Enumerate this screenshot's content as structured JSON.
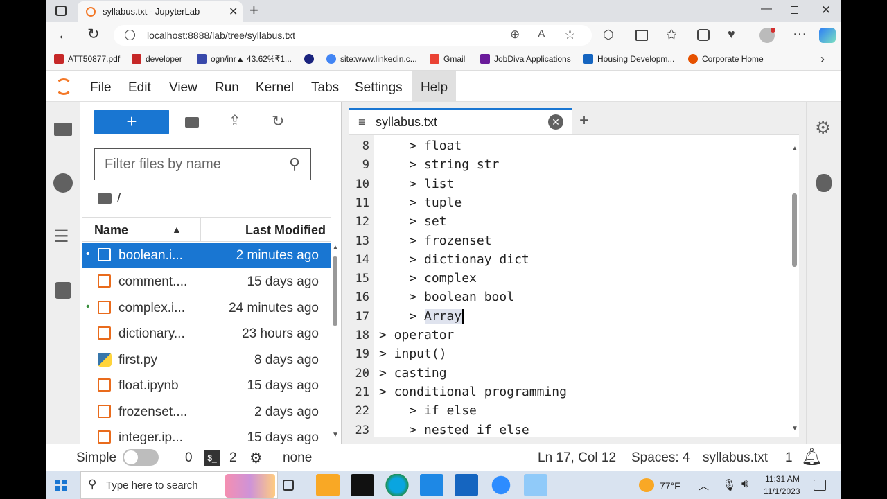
{
  "browser": {
    "tab_title": "syllabus.txt - JupyterLab",
    "url": "localhost:8888/lab/tree/syllabus.txt",
    "bookmarks": [
      {
        "label": "ATT50877.pdf",
        "color": "#c62828"
      },
      {
        "label": "developer",
        "color": "#c62828"
      },
      {
        "label": "ogn/inr▲ 43.62%₹1...",
        "color": "#3949ab"
      },
      {
        "label": "",
        "color": "#1a237e"
      },
      {
        "label": "site:www.linkedin.c...",
        "color": "#4285f4"
      },
      {
        "label": "Gmail",
        "color": "#ea4335"
      },
      {
        "label": "JobDiva Applications",
        "color": "#6a1b9a"
      },
      {
        "label": "Housing Developm...",
        "color": "#1565c0"
      },
      {
        "label": "Corporate Home",
        "color": "#e65100"
      }
    ]
  },
  "menubar": {
    "items": [
      "File",
      "Edit",
      "View",
      "Run",
      "Kernel",
      "Tabs",
      "Settings",
      "Help"
    ]
  },
  "filebrowser": {
    "new_label": "+",
    "filter_placeholder": "Filter files by name",
    "path": "/",
    "col_name": "Name",
    "col_modified": "Last Modified",
    "files": [
      {
        "name": "boolean.i...",
        "modified": "2 minutes ago",
        "selected": true,
        "running": true,
        "type": "notebook"
      },
      {
        "name": "comment....",
        "modified": "15 days ago",
        "selected": false,
        "running": false,
        "type": "notebook"
      },
      {
        "name": "complex.i...",
        "modified": "24 minutes ago",
        "selected": false,
        "running": true,
        "type": "notebook"
      },
      {
        "name": "dictionary...",
        "modified": "23 hours ago",
        "selected": false,
        "running": false,
        "type": "notebook"
      },
      {
        "name": "first.py",
        "modified": "8 days ago",
        "selected": false,
        "running": false,
        "type": "python"
      },
      {
        "name": "float.ipynb",
        "modified": "15 days ago",
        "selected": false,
        "running": false,
        "type": "notebook"
      },
      {
        "name": "frozenset....",
        "modified": "2 days ago",
        "selected": false,
        "running": false,
        "type": "notebook"
      },
      {
        "name": "integer.ip...",
        "modified": "15 days ago",
        "selected": false,
        "running": false,
        "type": "notebook"
      }
    ]
  },
  "editor": {
    "tab_title": "syllabus.txt",
    "lines": [
      {
        "n": "8",
        "text": "    > float"
      },
      {
        "n": "9",
        "text": "    > string str"
      },
      {
        "n": "10",
        "text": "    > list"
      },
      {
        "n": "11",
        "text": "    > tuple"
      },
      {
        "n": "12",
        "text": "    > set"
      },
      {
        "n": "13",
        "text": "    > frozenset"
      },
      {
        "n": "14",
        "text": "    > dictionay dict"
      },
      {
        "n": "15",
        "text": "    > complex"
      },
      {
        "n": "16",
        "text": "    > boolean bool"
      },
      {
        "n": "17",
        "text": "    > Array"
      },
      {
        "n": "18",
        "text": "> operator"
      },
      {
        "n": "19",
        "text": "> input()"
      },
      {
        "n": "20",
        "text": "> casting"
      },
      {
        "n": "21",
        "text": "> conditional programming"
      },
      {
        "n": "22",
        "text": "    > if else"
      },
      {
        "n": "23",
        "text": "    > nested if else"
      }
    ]
  },
  "statusbar": {
    "mode": "Simple",
    "kernels": "0",
    "terminals": "2",
    "kernel_state": "none",
    "cursor": "Ln 17, Col 12",
    "spaces": "Spaces: 4",
    "filename": "syllabus.txt",
    "notifications": "1"
  },
  "taskbar": {
    "search_placeholder": "Type here to search",
    "weather": "77°F",
    "time": "11:31 AM",
    "date": "11/1/2023"
  }
}
